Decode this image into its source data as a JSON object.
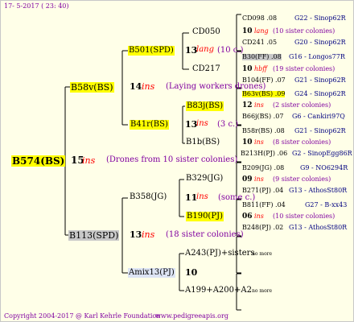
{
  "header": {
    "date": "17-  5-2017 ( 23: 40)"
  },
  "footer": {
    "copyright": "Copyright 2004-2017 @ Karl Kehrle Foundation",
    "site": "www.pedigreeapis.org"
  },
  "root": {
    "id": "B574(BS)",
    "num": "15",
    "ins": "ins",
    "note": "(Drones from 10 sister colonies)"
  },
  "gen1": {
    "sire": {
      "id": "B58v(BS)",
      "num": "14",
      "ins": "ins",
      "note": "(Laying workers drones)"
    },
    "dam": {
      "id": "B113(SPD)",
      "num": "13",
      "ins": "ins",
      "note": "(18 sister colonies)"
    }
  },
  "gen2": {
    "b501": {
      "id": "B501(SPD)",
      "num": "13",
      "ins": "lang",
      "note": "(10 c.)"
    },
    "b41r": {
      "id": "B41r(BS)",
      "num": "13",
      "ins": "ins",
      "note": "(3 c.)"
    },
    "b358": {
      "id": "B358(JG)",
      "num": "11",
      "ins": "ins",
      "note": "(some c.)"
    },
    "amix": {
      "id": "Amix13(PJ)",
      "num": "10"
    }
  },
  "gen3": {
    "cd050": "CD050",
    "cd217": "CD217",
    "b83j": {
      "id": "B83j(BS)",
      "num": "12",
      "ins": "ins",
      "note": "(2 sister colonies)"
    },
    "b1b": {
      "id": "B1b(BS)",
      "num": "10",
      "ins": "ins",
      "note": "(8 sister colonies)"
    },
    "b329": {
      "id": "B329(JG)",
      "num": "09",
      "ins": "ins",
      "note": "(9 sister colonies)"
    },
    "b190": {
      "id": "B190(PJ)",
      "num": "06",
      "ins": "ins",
      "note": "(10 sister colonies)"
    },
    "a243": {
      "id": "A243(PJ)+sisters",
      "more": "no more"
    },
    "a199": {
      "id": "A199+A200+A2",
      "more": "no more"
    }
  },
  "gen4": {
    "cd098": {
      "left": "CD098 .08",
      "right": "G22 - Sinop62R"
    },
    "cd098_num": "10",
    "cd098_ins": "lang",
    "cd098_note": "(10 sister colonies)",
    "cd241": {
      "left": "CD241 .05",
      "right": "G20 - Sinop62R"
    },
    "b30": {
      "left": "B30(FF) .08",
      "right": "G16 - Longos77R"
    },
    "b30_num": "10",
    "b30_ins": "hbff",
    "b30_note": "(19 sister colonies)",
    "b104": {
      "left": "B104(FF) .07",
      "right": "G21 - Sinop62R"
    },
    "b63v": {
      "left": "B63v(BS) .09",
      "right": "G24 - Sinop62R"
    },
    "b66j": {
      "left": "B66j(BS) .07",
      "right": "G6 - Cankiri97Q"
    },
    "b58r": {
      "left": "B58r(BS) .08",
      "right": "G21 - Sinop62R"
    },
    "b213h": {
      "left": "B213H(PJ) .06",
      "right": "G2 - SinopEgg86R"
    },
    "b209": {
      "left": "B209(JG) .08",
      "right": "G9 - NO6294R"
    },
    "b271": {
      "left": "B271(PJ) .04",
      "right": "G13 - AthosSt80R"
    },
    "b811": {
      "left": "B811(FF) .04",
      "right": "G27 - B-xx43"
    },
    "b248": {
      "left": "B248(PJ) .02",
      "right": "G13 - AthosSt80R"
    }
  }
}
